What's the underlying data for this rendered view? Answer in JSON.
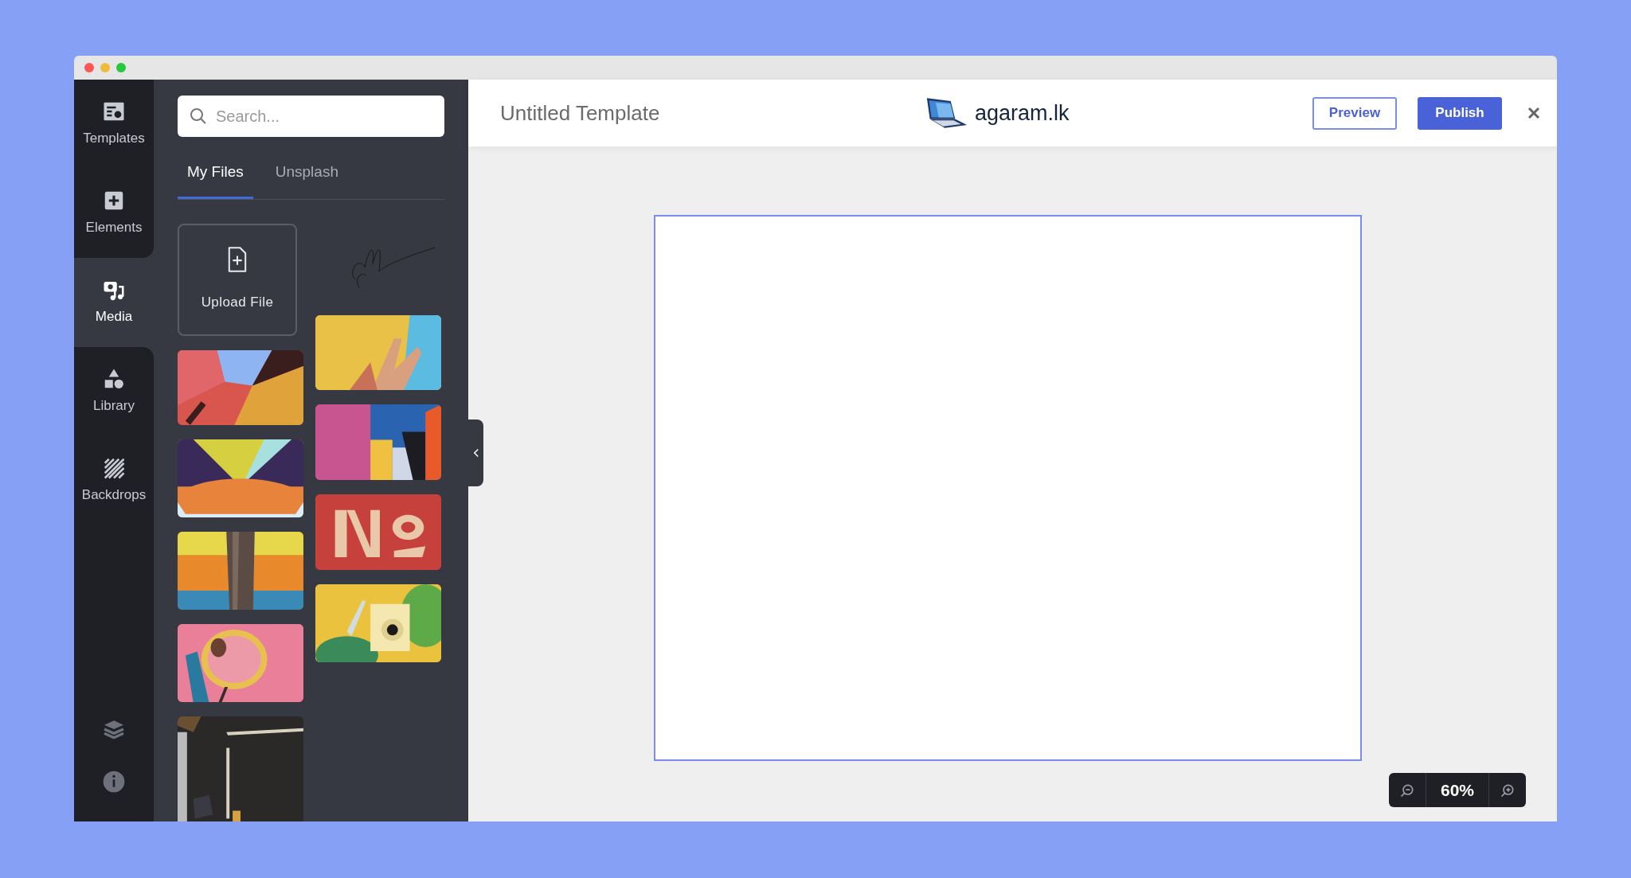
{
  "rail": {
    "items": [
      {
        "label": "Templates",
        "selected": false
      },
      {
        "label": "Elements",
        "selected": false
      },
      {
        "label": "Media",
        "selected": true
      },
      {
        "label": "Library",
        "selected": false
      },
      {
        "label": "Backdrops",
        "selected": false
      }
    ]
  },
  "panel": {
    "search": {
      "placeholder": "Search..."
    },
    "tabs": [
      {
        "label": "My Files",
        "selected": true
      },
      {
        "label": "Unsplash",
        "selected": false
      }
    ],
    "upload": {
      "label": "Upload File"
    },
    "columns": [
      [
        {
          "kind": "upload"
        },
        {
          "kind": "picture"
        },
        {
          "kind": "picture"
        },
        {
          "kind": "picture"
        },
        {
          "kind": "picture"
        },
        {
          "kind": "picture"
        }
      ],
      [
        {
          "kind": "picture"
        },
        {
          "kind": "picture"
        },
        {
          "kind": "picture"
        },
        {
          "kind": "picture"
        },
        {
          "kind": "picture"
        }
      ]
    ]
  },
  "header": {
    "title": "Untitled Template",
    "logo": "agaram.lk",
    "buttons": [
      {
        "label": "Preview",
        "kind": "outline"
      },
      {
        "label": "Publish",
        "kind": "primary"
      }
    ]
  },
  "zoom": {
    "reading": "60%"
  }
}
